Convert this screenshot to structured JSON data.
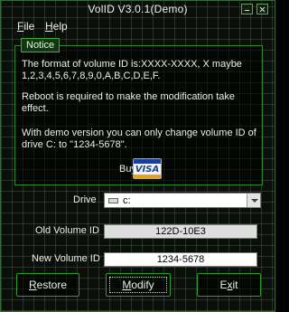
{
  "window": {
    "title": "VolID V3.0.1(Demo)"
  },
  "menu": {
    "file": {
      "key": "F",
      "rest": "ile"
    },
    "help": {
      "key": "H",
      "rest": "elp"
    }
  },
  "notice": {
    "legend": "Notice",
    "lines": [
      "The format of volume ID is:XXXX-XXXX, X maybe",
      "1,2,3,4,5,6,7,8,9,0,A,B,C,D,E,F.",
      "Reboot is required to make the modification take",
      "effect.",
      "With demo version you can only change volume ID of",
      "drive C: to \"1234-5678\"."
    ],
    "buy_label": "Buy It",
    "card_text": "VISA"
  },
  "form": {
    "drive_label": "Drive",
    "drive_value": "c:",
    "old_id_label": "Old Volume ID",
    "old_id_value": "122D-10E3",
    "new_id_label": "New Volume ID",
    "new_id_value": "1234-5678"
  },
  "buttons": {
    "restore": {
      "key": "R",
      "rest": "estore"
    },
    "modify": {
      "key": "M",
      "rest": "odify"
    },
    "exit": {
      "pre": "E",
      "key": "x",
      "rest": "it"
    }
  },
  "colors": {
    "background": "#0a0f0a",
    "grid": "#287828",
    "border": "#2aa02a",
    "text": "#e8f0e8"
  },
  "icons": [
    "minimize-icon",
    "close-icon",
    "drive-icon",
    "chevron-down-icon",
    "visa-icon"
  ]
}
